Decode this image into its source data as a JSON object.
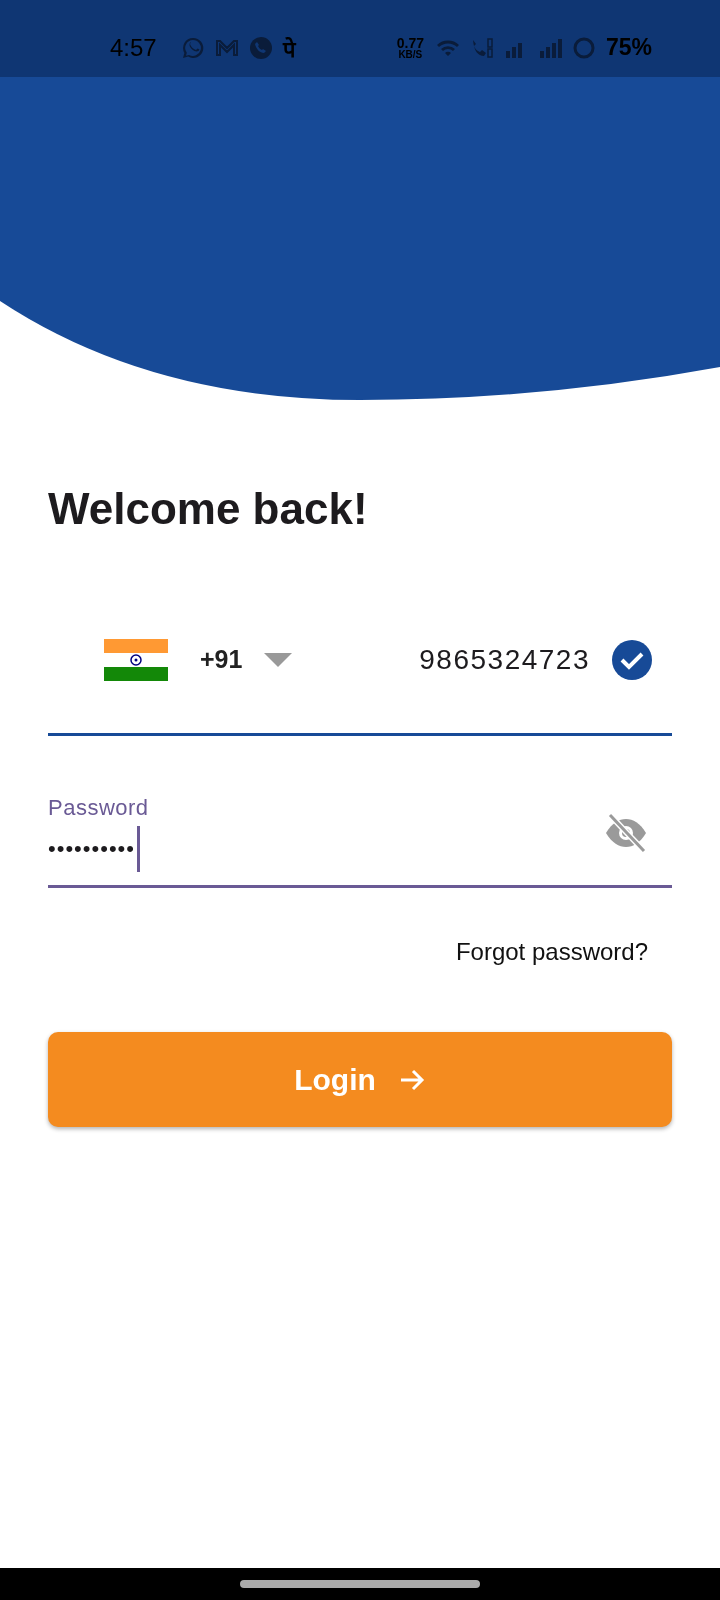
{
  "status_bar": {
    "time": "4:57",
    "app_glyph": "पे",
    "speed_value": "0.77",
    "speed_unit": "KB/S",
    "battery": "75%"
  },
  "title": "Welcome back!",
  "phone": {
    "country_code": "+91",
    "value": "9865324723",
    "verified": true
  },
  "password": {
    "label": "Password",
    "value": "••••••••••",
    "focused": true,
    "visible": false
  },
  "forgot_link": "Forgot password?",
  "login_button": "Login"
}
